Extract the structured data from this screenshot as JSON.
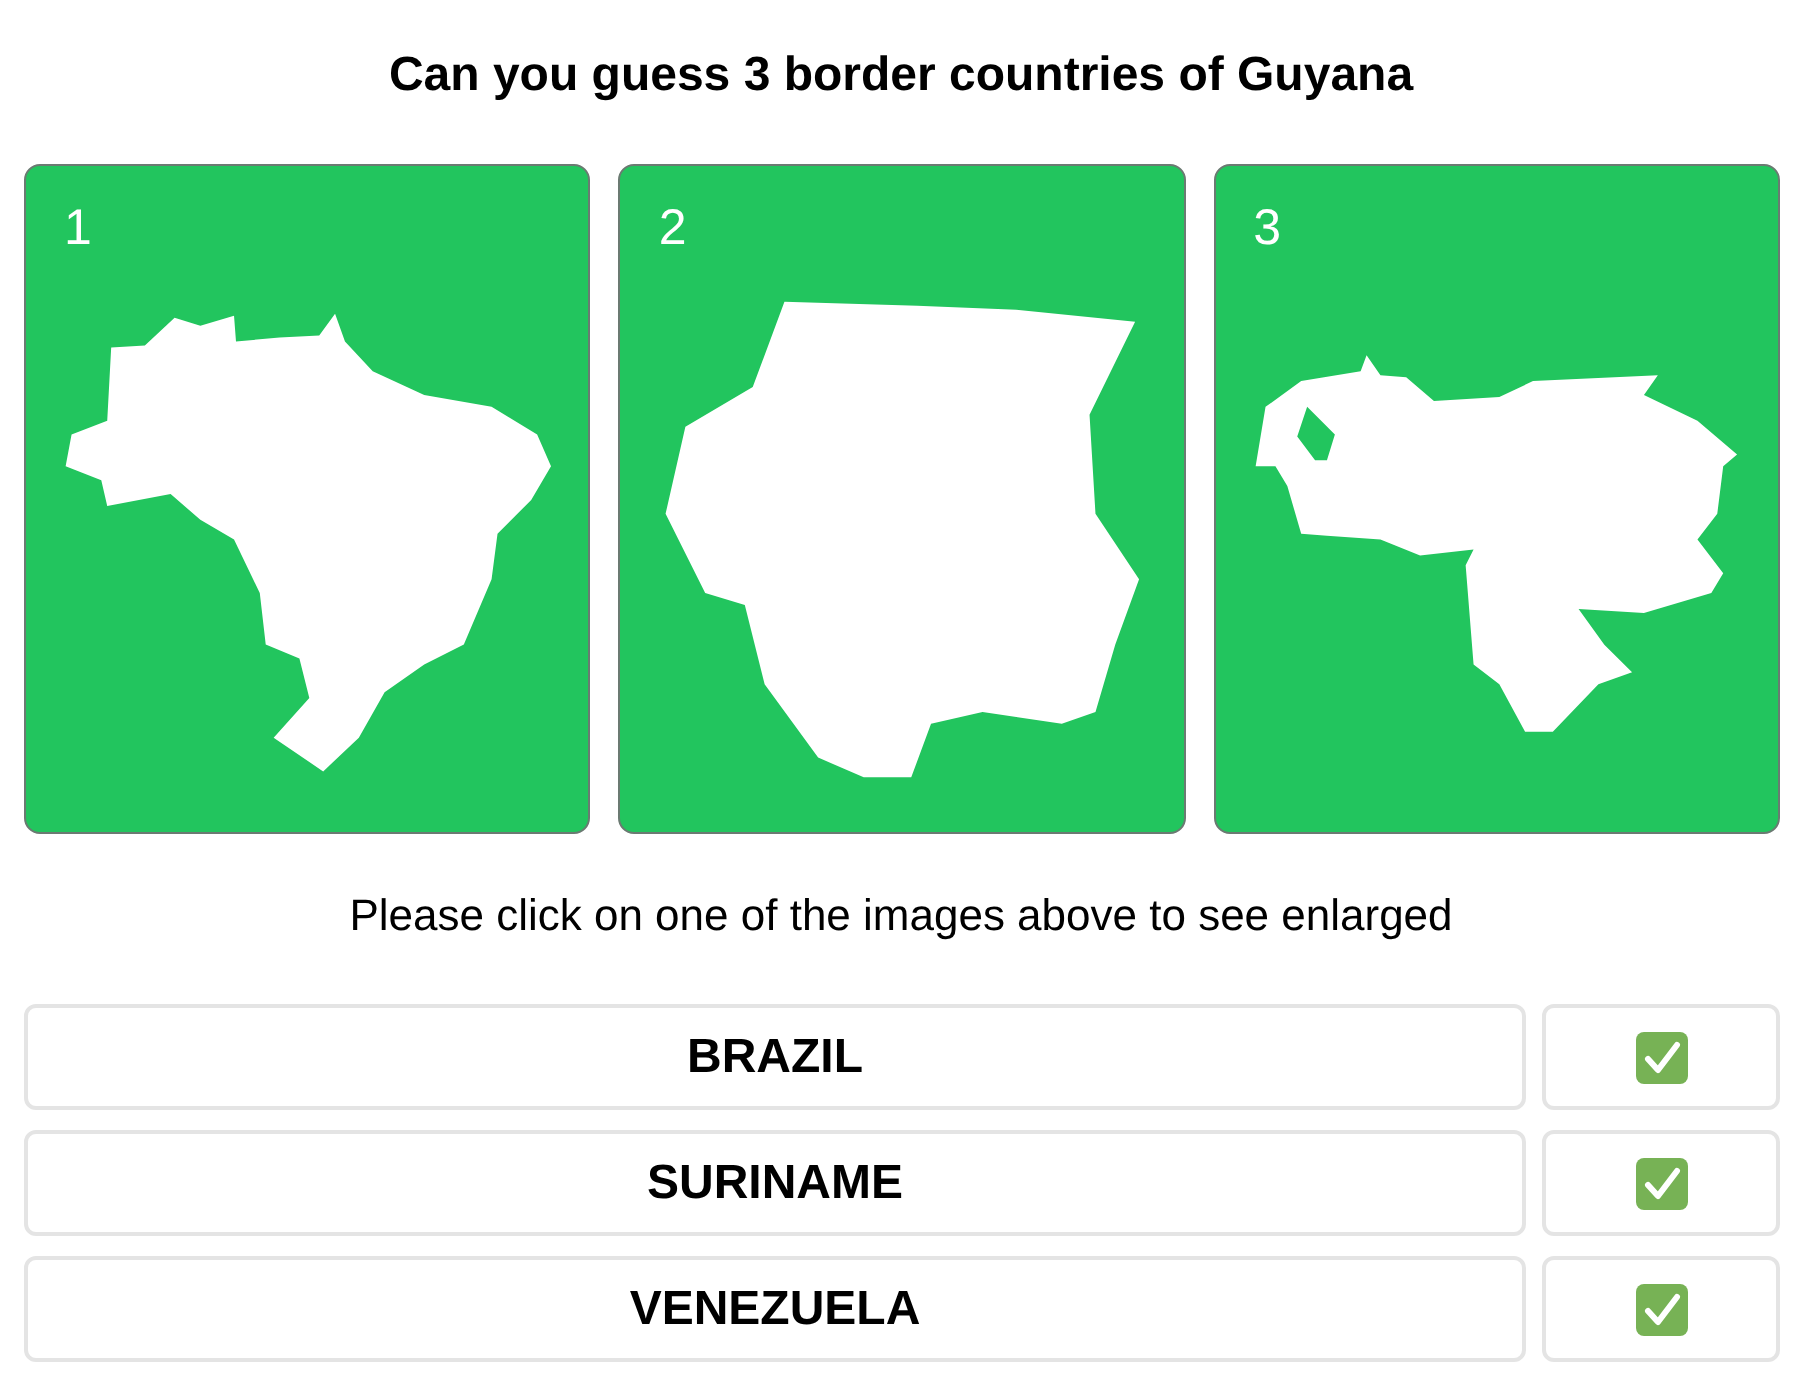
{
  "title": "Can you guess 3 border countries of Guyana",
  "maps": [
    {
      "label": "1"
    },
    {
      "label": "2"
    },
    {
      "label": "3"
    }
  ],
  "instruction": "Please click on one of the images above to see enlarged",
  "answers": [
    {
      "name": "BRAZIL",
      "correct": true
    },
    {
      "name": "SURINAME",
      "correct": true
    },
    {
      "name": "VENEZUELA",
      "correct": true
    }
  ]
}
